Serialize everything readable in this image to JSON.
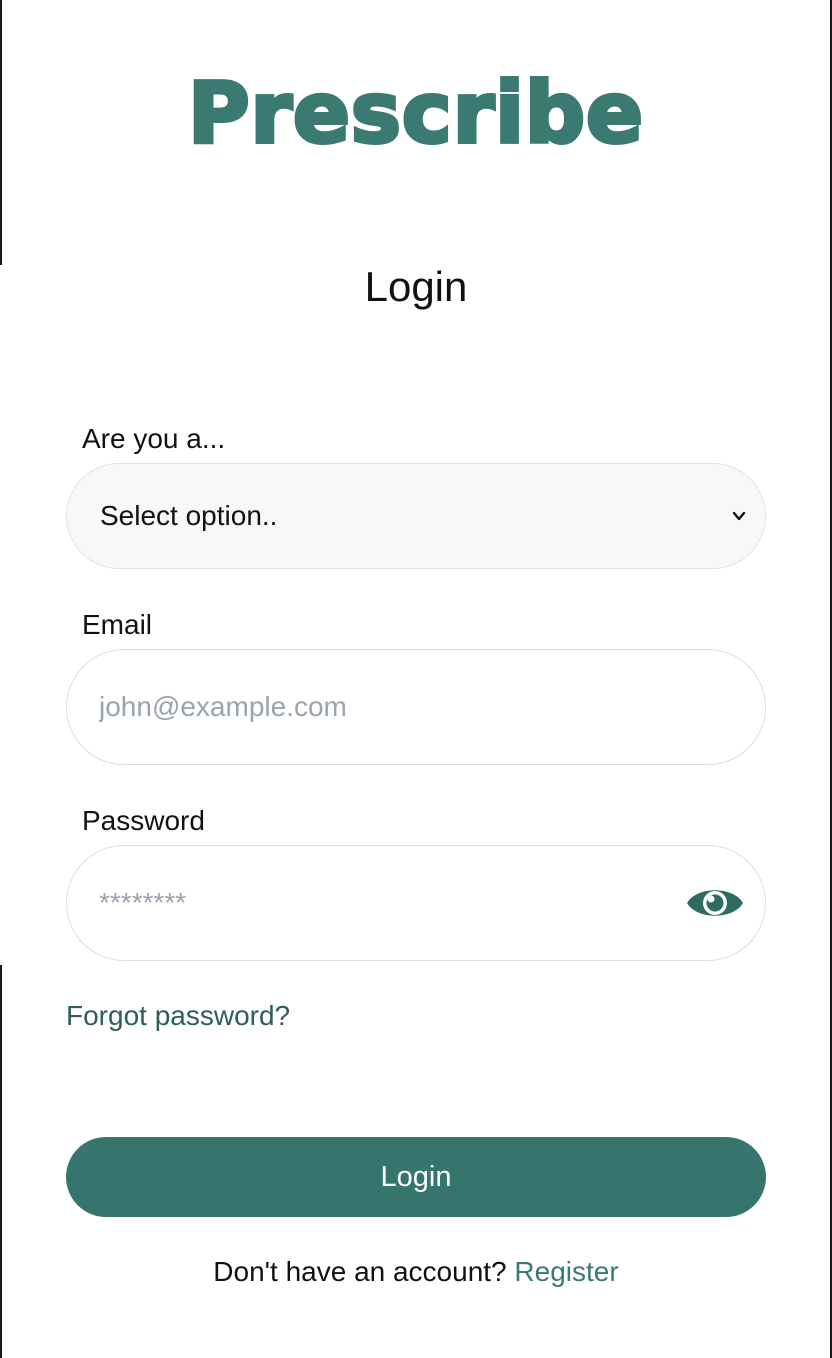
{
  "app": {
    "logo_text": "Prescribe",
    "brand_color": "#3a7a72"
  },
  "page": {
    "title": "Login"
  },
  "role_field": {
    "label": "Are you a...",
    "selected_value": "Select option..",
    "icon": "chevron-down-icon"
  },
  "email_field": {
    "label": "Email",
    "value": "",
    "placeholder": "john@example.com"
  },
  "password_field": {
    "label": "Password",
    "value": "",
    "placeholder": "********",
    "toggle_icon": "eye-icon"
  },
  "links": {
    "forgot_password": "Forgot password?",
    "no_account_text": "Don't have an account?",
    "register": "Register"
  },
  "buttons": {
    "login": "Login",
    "login_color": "#36756e"
  }
}
